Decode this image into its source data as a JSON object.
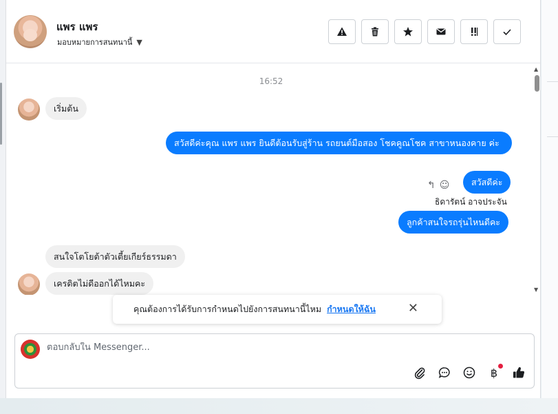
{
  "header": {
    "contact_name": "แพร แพร",
    "assign_label": "มอบหมายการสนทนานี้",
    "actions": [
      {
        "name": "spam-button",
        "icon": "warning-icon"
      },
      {
        "name": "delete-button",
        "icon": "trash-icon"
      },
      {
        "name": "star-button",
        "icon": "star-icon"
      },
      {
        "name": "mark-unread-button",
        "icon": "envelope-icon"
      },
      {
        "name": "follow-up-button",
        "icon": "exclamation-icon"
      },
      {
        "name": "done-button",
        "icon": "check-icon"
      }
    ]
  },
  "messages": {
    "timestamp": "16:52",
    "items": [
      {
        "direction": "in",
        "text": "เริ่มต้น"
      },
      {
        "direction": "out",
        "text": "สวัสดีค่ะคุณ แพร แพร ยินดีต้อนรับสู่ร้าน รถยนต์มือสอง โชคคูณโชค สาขาหนองคาย ค่ะ"
      },
      {
        "direction": "out",
        "text": "สวัสดีค่ะ"
      },
      {
        "direction": "out",
        "text": "ลูกค้าสนใจรถรุ่นไหนดีคะ"
      },
      {
        "direction": "in",
        "text": "สนใจโตโยต้าตัวเตี้ยเกียร์ธรรมดา"
      },
      {
        "direction": "in",
        "text": "เครดิตไม่ดีออกได้ไหมคะ"
      }
    ],
    "sender_name": "ธิดารัตน์ อาจประจัน"
  },
  "toast": {
    "text": "คุณต้องการได้รับการกำหนดไปยังการสนทนานี้ไหม",
    "link": "กำหนดให้ฉัน"
  },
  "composer": {
    "placeholder": "ตอบกลับใน Messenger...",
    "tools": [
      "paperclip-icon",
      "chat-bubble-icon",
      "emoji-icon",
      "baht-icon",
      "thumbs-up-icon"
    ]
  },
  "colors": {
    "outgoing_bubble": "#0a7cff",
    "incoming_bubble": "#f0f0f0",
    "link": "#1877f2"
  }
}
